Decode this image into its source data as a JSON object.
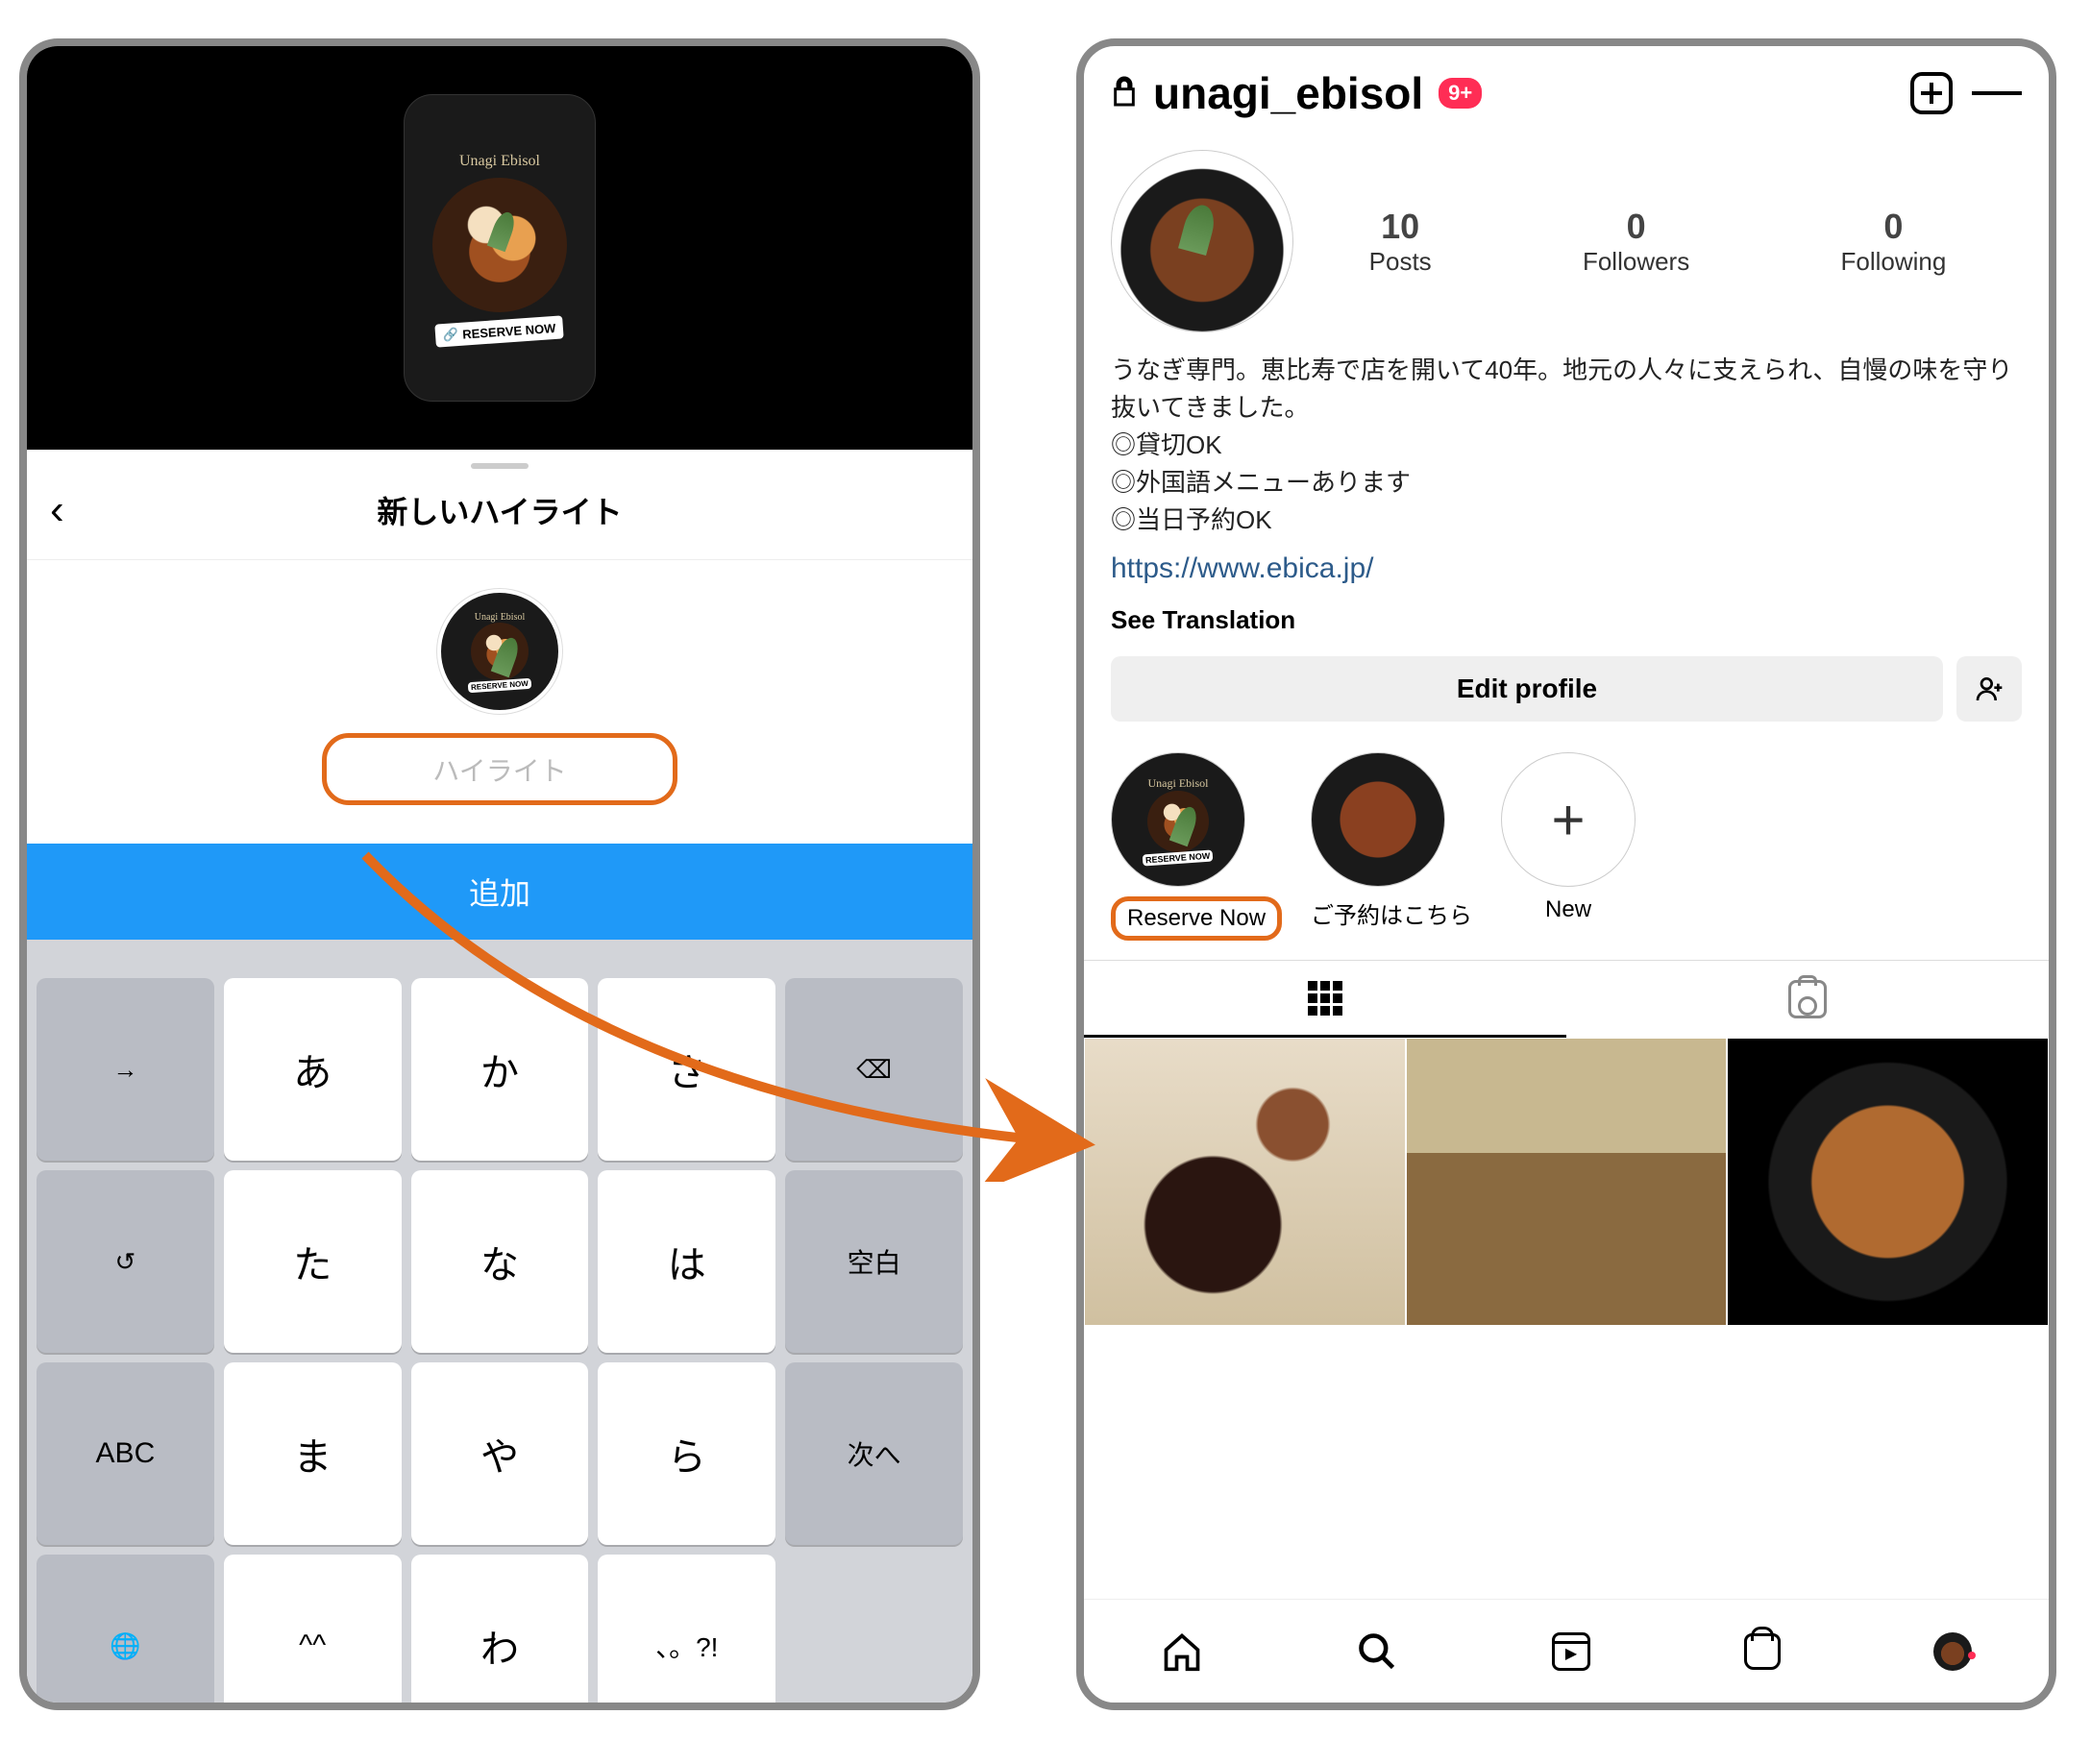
{
  "left": {
    "story_preview": {
      "brand": "Unagi Ebisol",
      "tag": "RESERVE NOW"
    },
    "sheet_title": "新しいハイライト",
    "cover_brand": "Unagi Ebisol",
    "cover_tag": "RESERVE NOW",
    "input_placeholder": "ハイライト",
    "add_button": "追加",
    "keyboard": {
      "r1": [
        "→",
        "あ",
        "か",
        "さ",
        "⌫"
      ],
      "r2": [
        "↺",
        "た",
        "な",
        "は",
        "空白"
      ],
      "r3": [
        "ABC",
        "ま",
        "や",
        "ら",
        "次へ"
      ],
      "r4": [
        "🌐",
        "^^",
        "わ",
        "、。?!",
        ""
      ]
    }
  },
  "right": {
    "username": "unagi_ebisol",
    "badge": "9+",
    "stats": {
      "posts_num": "10",
      "posts_lbl": "Posts",
      "followers_num": "0",
      "followers_lbl": "Followers",
      "following_num": "0",
      "following_lbl": "Following"
    },
    "bio_line1": "うなぎ専門。恵比寿で店を開いて40年。地元の人々に支えられ、自慢の味を守り抜いてきました。",
    "bio_line2": "◎貸切OK",
    "bio_line3": "◎外国語メニューあります",
    "bio_line4": "◎当日予約OK",
    "link": "https://www.ebica.jp/",
    "see_translation": "See Translation",
    "edit_profile": "Edit profile",
    "highlights": {
      "h1": "Reserve Now",
      "h2": "ご予約はこちら",
      "h3": "New"
    }
  }
}
